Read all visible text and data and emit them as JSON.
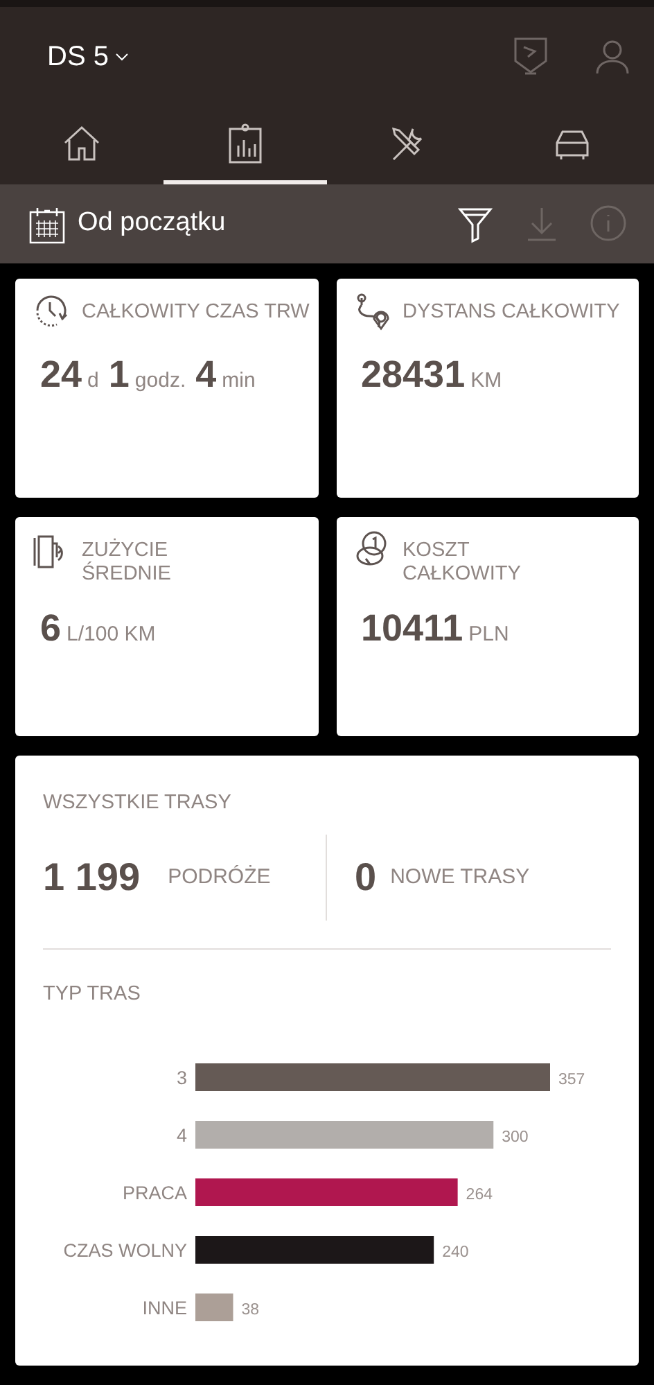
{
  "header": {
    "model": "DS 5"
  },
  "tabs": [
    {
      "kind": "home",
      "selected": false
    },
    {
      "kind": "stats",
      "selected": true
    },
    {
      "kind": "tools",
      "selected": false
    },
    {
      "kind": "car",
      "selected": false
    }
  ],
  "toolbar": {
    "period": "Od początku",
    "actions": [
      {
        "kind": "filter",
        "disabled": false
      },
      {
        "kind": "download",
        "disabled": true
      },
      {
        "kind": "info",
        "disabled": true
      }
    ]
  },
  "cards": [
    {
      "kind": "time",
      "title": "CAŁKOWITY CZAS TRW",
      "parts": [
        {
          "value": "24",
          "unit": "d"
        },
        {
          "value": "1",
          "unit": "godz."
        },
        {
          "value": "4",
          "unit": "min"
        }
      ]
    },
    {
      "kind": "distance",
      "title": "DYSTANS CAŁKOWITY",
      "parts": [
        {
          "value": "28431",
          "unit": "KM"
        }
      ]
    },
    {
      "kind": "fuel",
      "title": "ZUŻYCIE ŚREDNIE",
      "parts": [
        {
          "value": "6",
          "unit": "L/100 KM"
        }
      ]
    },
    {
      "kind": "cost",
      "title": "KOSZT CAŁKOWITY",
      "parts": [
        {
          "value": "10411",
          "unit": "PLN"
        }
      ]
    }
  ],
  "trips": {
    "title": "WSZYSTKIE TRASY",
    "total": "1 199",
    "total_label": "PODRÓŻE",
    "new": "0",
    "new_label": "NOWE TRASY",
    "type_title": "TYP TRAS",
    "chart_data": {
      "type": "bar",
      "orientation": "horizontal",
      "categories": [
        "3",
        "4",
        "PRACA",
        "CZAS WOLNY",
        "INNE"
      ],
      "series": [
        {
          "values": [
            357,
            300,
            264,
            240,
            38
          ],
          "colors": [
            "#655a55",
            "#b2aeab",
            "#b0174f",
            "#1c1718",
            "#ac9f97"
          ]
        }
      ],
      "data_labels": true
    }
  }
}
